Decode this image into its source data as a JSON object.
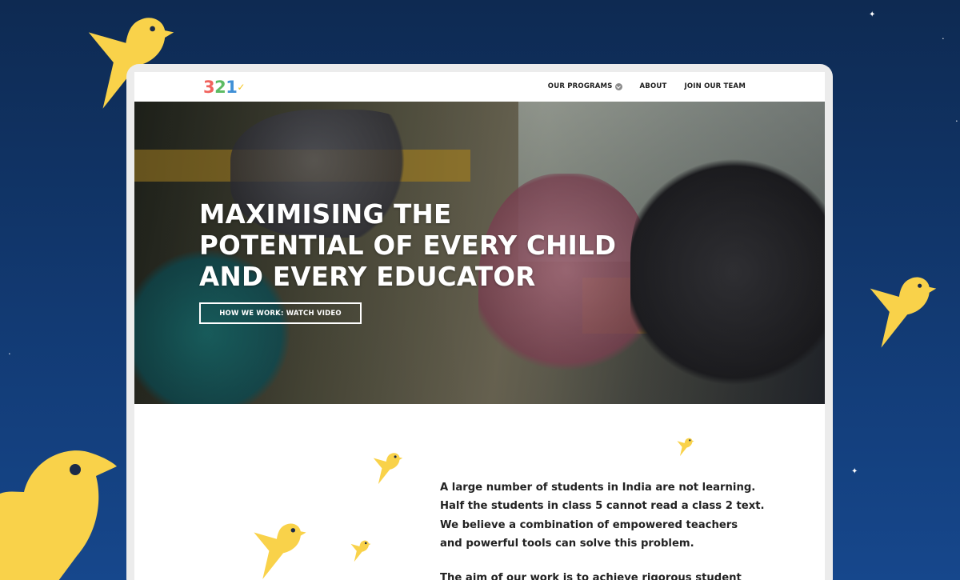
{
  "site": {
    "logo": {
      "digit1": "3",
      "digit2": "2",
      "digit3": "1",
      "mark": "✓"
    },
    "nav": [
      {
        "label": "OUR PROGRAMS",
        "has_dropdown": true
      },
      {
        "label": "ABOUT"
      },
      {
        "label": "JOIN OUR TEAM"
      }
    ]
  },
  "hero": {
    "title_lines": [
      "MAXIMISING THE",
      "POTENTIAL OF EVERY CHILD",
      "AND EVERY EDUCATOR"
    ],
    "button_label": "HOW WE WORK: WATCH VIDEO"
  },
  "intro": {
    "paragraph1_lines": [
      "A large number of students in India are not learning.",
      "Half the students in class 5 cannot read a class 2 text.",
      "We believe a combination of empowered teachers",
      "and powerful tools can solve this problem."
    ],
    "paragraph2_lines": [
      "The aim of our work is to achieve rigorous student"
    ]
  },
  "colors": {
    "background_top": "#0e2a52",
    "background_bottom": "#16478c",
    "bird_yellow": "#f9d24a",
    "logo_red": "#f0625c",
    "logo_green": "#5dbb63",
    "logo_blue": "#3f8fd6"
  },
  "icons": [
    "bird-icon",
    "star-icon",
    "chevron-down-icon"
  ]
}
